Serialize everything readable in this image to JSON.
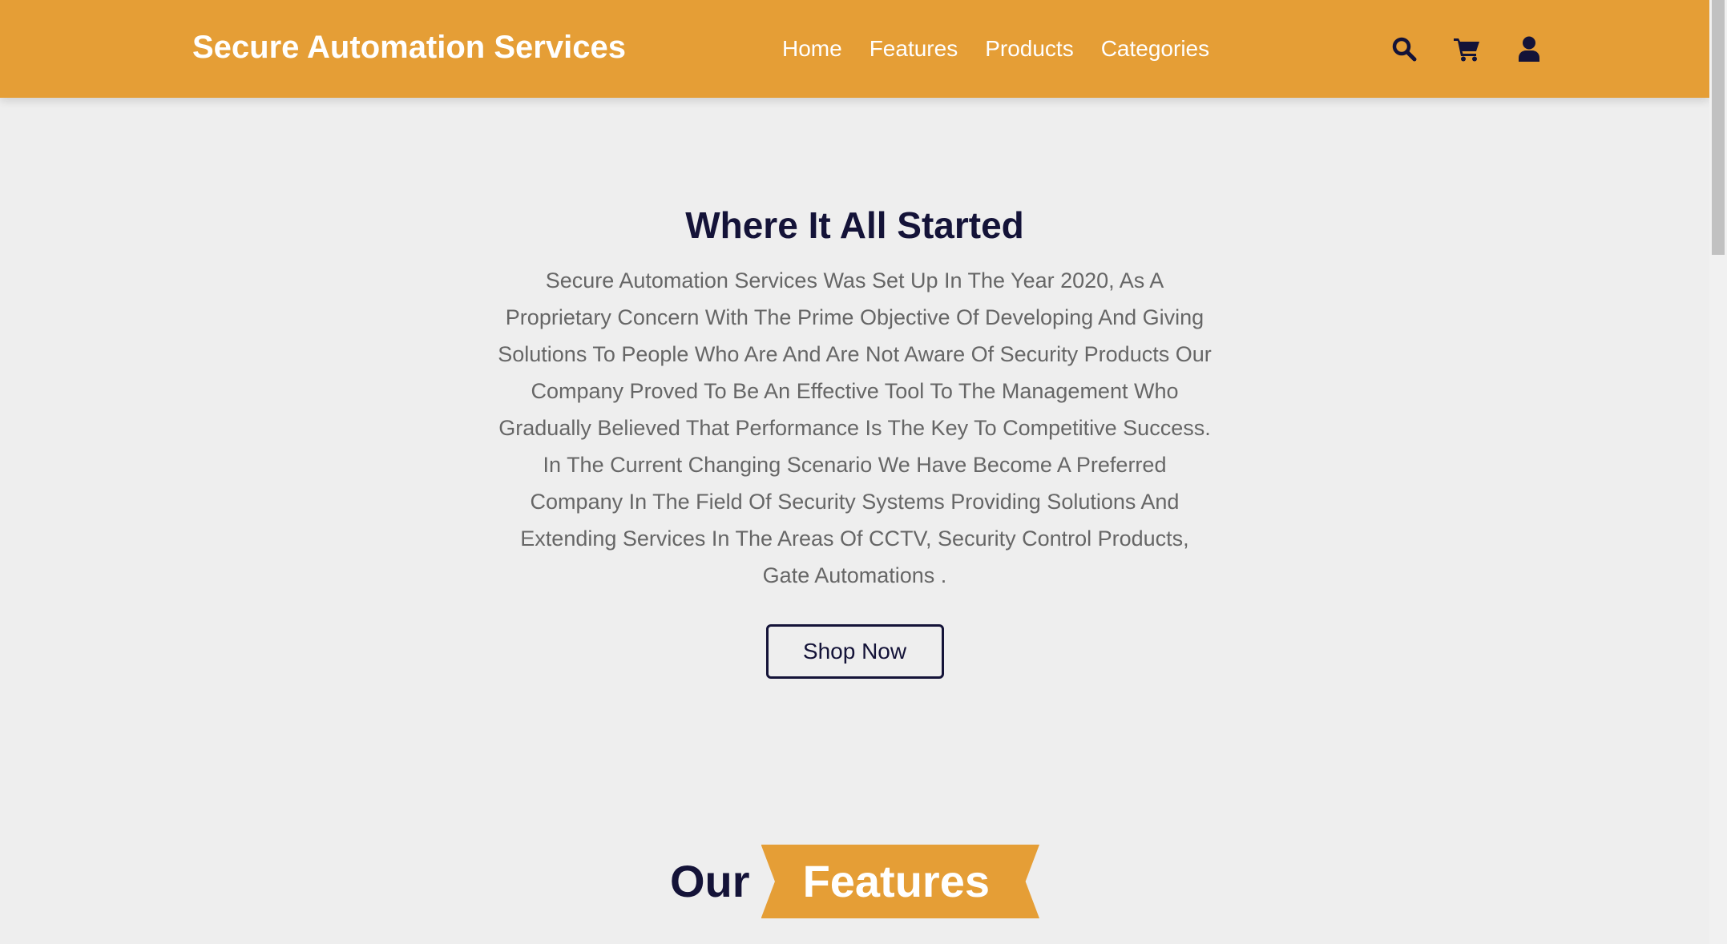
{
  "header": {
    "brand": "Secure Automation Services",
    "nav": [
      "Home",
      "Features",
      "Products",
      "Categories"
    ],
    "icons": [
      "search-icon",
      "cart-icon",
      "user-icon"
    ]
  },
  "about": {
    "title": "Where It All Started",
    "text": "Secure Automation Services Was Set Up In The Year 2020, As A Proprietary Concern With The Prime Objective Of Developing And Giving Solutions To People Who Are And Are Not Aware Of Security Products Our Company Proved To Be An Effective Tool To The Management Who Gradually Believed That Performance Is The Key To Competitive Success. In The Current Changing Scenario We Have Become A Preferred Company In The Field Of Security Systems Providing Solutions And Extending Services In The Areas Of CCTV, Security Control Products, Gate Automations .",
    "button_label": "Shop Now"
  },
  "features_heading": {
    "prefix": "Our",
    "highlight": "Features"
  },
  "colors": {
    "accent": "#e59e36",
    "navy": "#141338",
    "background": "#eeeeee",
    "body_text": "#666666"
  }
}
